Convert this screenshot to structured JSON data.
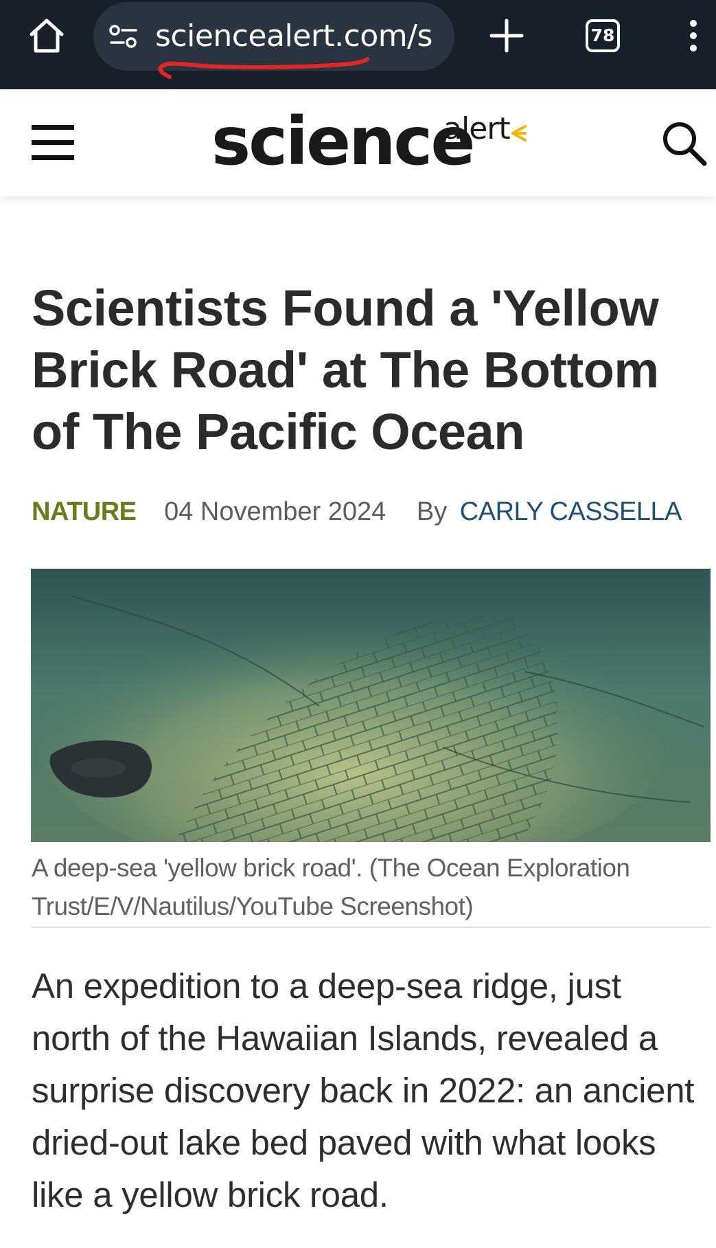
{
  "browser": {
    "url_text": "sciencealert.com/s",
    "tab_count": "78",
    "icons": {
      "home": "home-icon",
      "site_info": "tune-icon",
      "new_tab": "plus-icon",
      "tabs": "tab-switcher-icon",
      "menu": "more-vert-icon"
    },
    "annotation_color": "#e02626"
  },
  "site": {
    "logo_science": "science",
    "logo_alert": "alert",
    "logo_accent_color": "#f5b400",
    "icons": {
      "menu": "hamburger-icon",
      "search": "search-icon"
    }
  },
  "article": {
    "headline": "Scientists Found a 'Yellow Brick Road' at The Bottom of The Pacific Ocean",
    "category": "NATURE",
    "date": "04 November 2024",
    "by_label": "By",
    "author": "CARLY CASSELLA",
    "image_caption": "A deep-sea 'yellow brick road'. (The Ocean Exploration Trust/E/V/Nautilus/YouTube Screenshot)",
    "body": "An expedition to a deep-sea ridge, just north of the Hawaiian Islands, revealed a surprise discovery back in 2022: an ancient dried-out lake bed paved with what looks like a yellow brick road.",
    "colors": {
      "category": "#6b7a1a",
      "author": "#1f4f73"
    }
  }
}
